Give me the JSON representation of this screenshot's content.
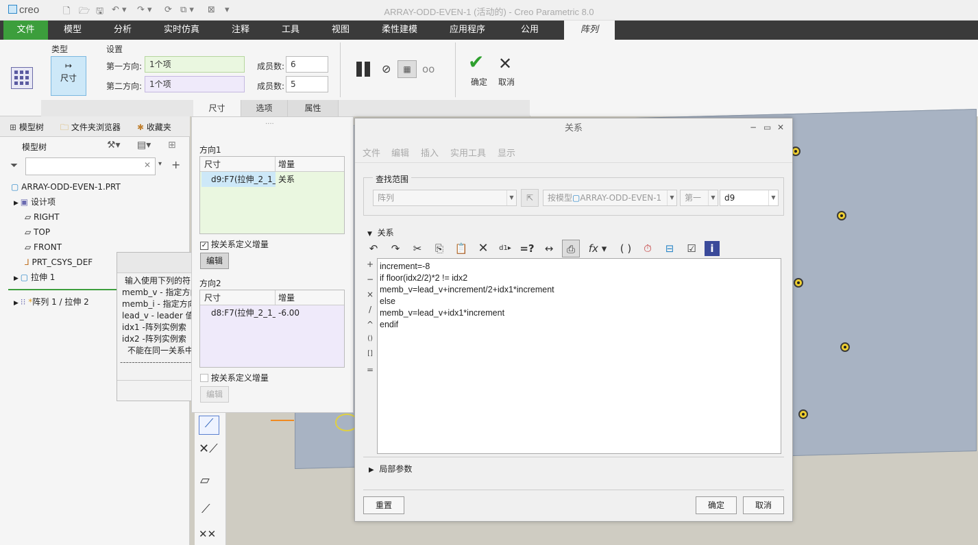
{
  "app": {
    "logo": "creo",
    "window_title": "ARRAY-ODD-EVEN-1 (活动的) - Creo Parametric 8.0"
  },
  "menu": [
    "文件",
    "模型",
    "分析",
    "实时仿真",
    "注释",
    "工具",
    "视图",
    "柔性建模",
    "应用程序",
    "公用",
    "阵列"
  ],
  "ribbon": {
    "type_label": "类型",
    "type_button": "尺寸",
    "settings_label": "设置",
    "dir1_label": "第一方向:",
    "dir1_value": "1个项",
    "dir2_label": "第二方向:",
    "dir2_value": "1个项",
    "members_label": "成员数:",
    "dir1_members": "6",
    "dir2_members": "5",
    "ok": "确定",
    "cancel": "取消",
    "tabs": [
      "尺寸",
      "选项",
      "属性"
    ]
  },
  "left": {
    "tabs": [
      "模型树",
      "文件夹浏览器",
      "收藏夹"
    ],
    "tree_title": "模型树",
    "search_placeholder": "",
    "items": [
      "ARRAY-ODD-EVEN-1.PRT",
      "设计项",
      "RIGHT",
      "TOP",
      "FRONT",
      "PRT_CSYS_DEF",
      "拉伸 1",
      "阵列 1 / 拉伸 2"
    ]
  },
  "popup": {
    "lines": [
      "输入使用下列的符",
      "memb_v - 指定方向",
      "memb_i - 指定方向",
      "lead_v - leader 值",
      "idx1   -阵列实例索",
      "idx2   -阵列实例索",
      "不能在同一关系中",
      "------------------------"
    ]
  },
  "dim_panel": {
    "dir1": "方向1",
    "dir2": "方向2",
    "col_dim": "尺寸",
    "col_inc": "增量",
    "row1_dim": "d9:F7(拉伸_2_1_",
    "row1_inc": "关系",
    "row2_dim": "d8:F7(拉伸_2_1_",
    "row2_inc": "-6.00",
    "chk1": "按关系定义增量",
    "chk2": "按关系定义增量",
    "edit": "编辑"
  },
  "dialog": {
    "title": "关系",
    "menu": [
      "文件",
      "编辑",
      "插入",
      "实用工具",
      "显示"
    ],
    "scope_label": "查找范围",
    "scope_value": "阵列",
    "by_model": "按模型",
    "model_name": "ARRAY-ODD-EVEN-1",
    "first": "第一",
    "dim": "d9",
    "relations_label": "关系",
    "ops": [
      "+",
      "−",
      "×",
      "/",
      "^",
      "()",
      "[]",
      "="
    ],
    "code": [
      "increment=-8",
      "if floor(idx2/2)*2 != idx2",
      "memb_v=lead_v+increment/2+idx1*increment",
      "else",
      "memb_v=lead_v+idx1*increment",
      "endif"
    ],
    "local_params": "局部参数",
    "reset": "重置",
    "ok": "确定",
    "cancel": "取消"
  }
}
